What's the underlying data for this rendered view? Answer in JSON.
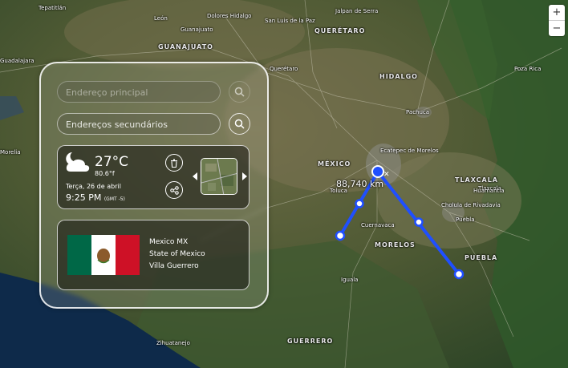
{
  "map": {
    "states": [
      "MÉXICO",
      "HIDALGO",
      "QUERÉTARO",
      "GUANAJUATO",
      "TLAXCALA",
      "MORELOS",
      "PUEBLA",
      "GUERRERO"
    ],
    "cities": [
      "Dolores Hidalgo",
      "San Luis de la Paz",
      "Jalpan de Serra",
      "Guadalajara",
      "León",
      "Guanajuato",
      "Querétaro",
      "Pachuca",
      "Ecatepec de Morelos",
      "Toluca",
      "Cuernavaca",
      "Iguala",
      "Puebla",
      "Cholula de Rivadavia",
      "Tlaxcala",
      "Huamantla",
      "Poza Rica",
      "Zihuatanejo",
      "Tepatitlán",
      "Morelia"
    ],
    "distance_label": "88,740 km",
    "route_color": "#1f4fff"
  },
  "zoom": {
    "in_label": "+",
    "out_label": "−"
  },
  "search": {
    "primary_placeholder": "Endereço principal",
    "secondary_placeholder": "Endereços secundários"
  },
  "weather": {
    "icon": "partly-cloudy-night-icon",
    "temp_c": "27°C",
    "temp_f": "80.6°f",
    "date": "Terça, 26 de abril",
    "time": "9:25 PM",
    "tz": "(GMT -5)"
  },
  "location": {
    "flag": "mexico-flag",
    "country": "Mexico MX",
    "state": "State of Mexico",
    "city": "Villa Guerrero"
  }
}
